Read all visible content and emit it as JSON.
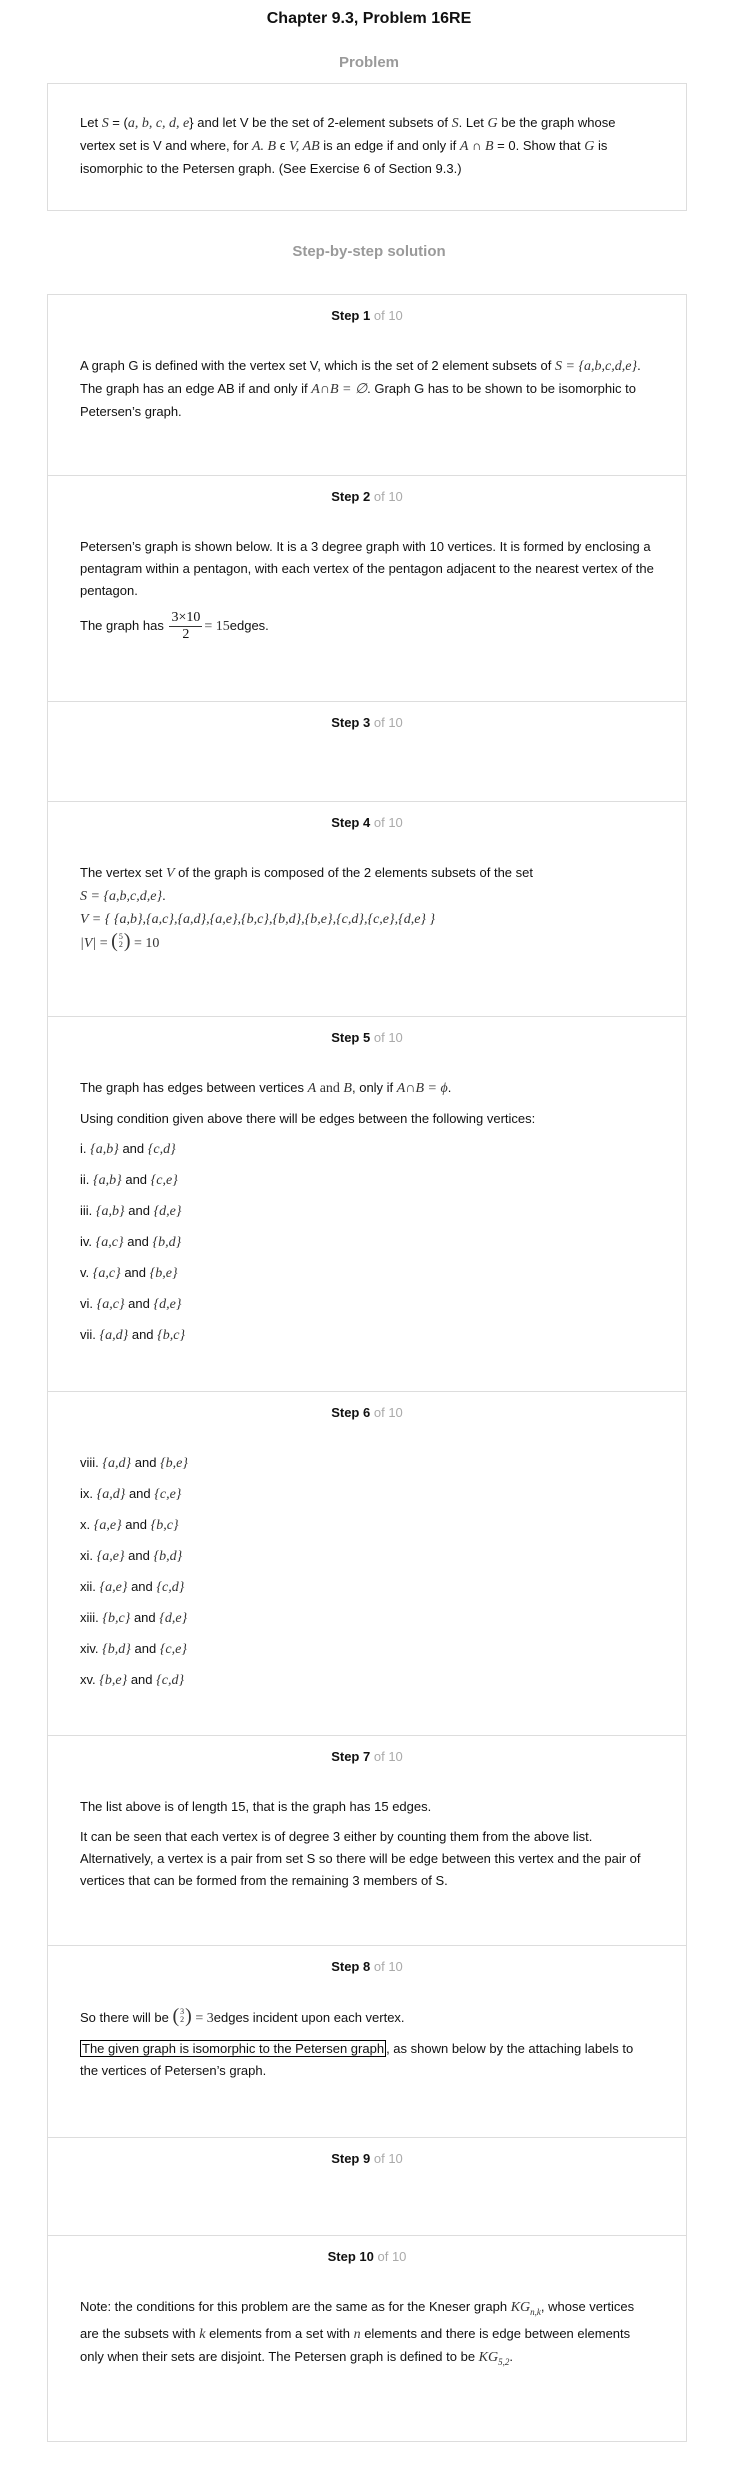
{
  "header": {
    "title": "Chapter 9.3, Problem 16RE",
    "problem_heading": "Problem",
    "solution_heading": "Step-by-step solution"
  },
  "problem": {
    "segments": [
      {
        "text": "Let "
      },
      {
        "math": "S"
      },
      {
        "text": " = ("
      },
      {
        "math": "a, b, c, d, e"
      },
      {
        "text": "} and let V be the set of 2-element subsets of "
      },
      {
        "math": "S"
      },
      {
        "text": ". Let "
      },
      {
        "math": "G"
      },
      {
        "text": " be the graph whose vertex set is V and where, for "
      },
      {
        "math": "A. B"
      },
      {
        "text": " ϵ "
      },
      {
        "math": "V, AB"
      },
      {
        "text": " is an edge if and only if "
      },
      {
        "math": "A"
      },
      {
        "text": " ∩ "
      },
      {
        "math": "B"
      },
      {
        "text": " = 0. Show that "
      },
      {
        "math": "G"
      },
      {
        "text": " is isomorphic to the Petersen graph. (See Exercise 6 of Section 9.3.)"
      }
    ]
  },
  "step_word": "Step",
  "of_total": "of 10",
  "steps": [
    {
      "number": "1",
      "paragraphs": [
        [
          {
            "text": "A graph G is defined with the vertex set V, which is the set of 2 element subsets of "
          },
          {
            "math": "S = {a,b,c,d,e}"
          },
          {
            "text": ". The graph has an edge AB if and only if "
          },
          {
            "math": "A∩B = ∅"
          },
          {
            "text": ". Graph G has to be shown to be isomorphic to Petersen’s graph."
          }
        ]
      ]
    },
    {
      "number": "2",
      "paragraphs": [
        [
          {
            "text": "Petersen’s graph is shown below. It is a 3 degree graph with 10 vertices. It is formed by enclosing a pentagram within a pentagon, with each vertex of the pentagon adjacent to the nearest vertex of the pentagon."
          }
        ],
        [
          {
            "text": "The graph has "
          },
          {
            "frac": [
              "3×10",
              "2"
            ]
          },
          {
            "roman": "= 15"
          },
          {
            "text": "edges."
          }
        ]
      ]
    },
    {
      "number": "3",
      "paragraphs": []
    },
    {
      "number": "4",
      "paragraphs": [
        [
          {
            "text": "The vertex set "
          },
          {
            "math": "V"
          },
          {
            "text": " of the graph is composed of the 2 elements subsets of the set"
          }
        ],
        [
          {
            "math": " S = {a,b,c,d,e}"
          },
          {
            "text": "."
          }
        ],
        [
          {
            "math": " V = { {a,b},{a,c},{a,d},{a,e},{b,c},{b,d},{b,e},{c,d},{c,e},{d,e} }"
          }
        ],
        [
          {
            "math": " |V|"
          },
          {
            "roman": " = "
          },
          {
            "binom": [
              "5",
              "2"
            ]
          },
          {
            "roman": " = 10"
          }
        ]
      ]
    },
    {
      "number": "5",
      "paragraphs": [
        [
          {
            "text": "The graph has edges between vertices "
          },
          {
            "math": "A"
          },
          {
            "roman": " and "
          },
          {
            "math": "B"
          },
          {
            "text": ", only if "
          },
          {
            "math": "A∩B = ϕ"
          },
          {
            "text": "."
          }
        ],
        [
          {
            "text": "Using condition given above there will be edges between the following vertices:"
          }
        ]
      ],
      "items": [
        {
          "num": "i.",
          "a": "{a,b}",
          "and": "and",
          "b": "{c,d}"
        },
        {
          "num": "ii.",
          "a": "{a,b}",
          "and": "and",
          "b": "{c,e}"
        },
        {
          "num": "iii.",
          "a": "{a,b}",
          "and": "and",
          "b": "{d,e}"
        },
        {
          "num": "iv.",
          "a": "{a,c}",
          "and": "and",
          "b": "{b,d}"
        },
        {
          "num": "v.",
          "a": "{a,c}",
          "and": "and",
          "b": "{b,e}"
        },
        {
          "num": "vi.",
          "a": "{a,c}",
          "and": "and",
          "b": "{d,e}"
        },
        {
          "num": "vii.",
          "a": "{a,d}",
          "and": "and",
          "b": "{b,c}"
        }
      ]
    },
    {
      "number": "6",
      "paragraphs": [],
      "items": [
        {
          "num": "viii.",
          "a": "{a,d}",
          "and": "and",
          "b": "{b,e}"
        },
        {
          "num": "ix.",
          "a": "{a,d}",
          "and": "and",
          "b": "{c,e}"
        },
        {
          "num": "x.",
          "a": "{a,e}",
          "and": "and",
          "b": "{b,c}"
        },
        {
          "num": "xi.",
          "a": "{a,e}",
          "and": "and",
          "b": "{b,d}"
        },
        {
          "num": "xii.",
          "a": "{a,e}",
          "and": "and",
          "b": "{c,d}"
        },
        {
          "num": "xiii.",
          "a": "{b,c}",
          "and": "and",
          "b": "{d,e}"
        },
        {
          "num": "xiv.",
          "a": "{b,d}",
          "and": "and",
          "b": "{c,e}"
        },
        {
          "num": "xv.",
          "a": "{b,e}",
          "and": "and",
          "b": "{c,d}"
        }
      ]
    },
    {
      "number": "7",
      "paragraphs": [
        [
          {
            "text": "The list above is of length 15, that is the graph has 15 edges."
          }
        ],
        [
          {
            "text": "It can be seen that each vertex is of degree 3 either by counting them from the above list. Alternatively, a vertex is a pair from set S so there will be edge between this vertex and the pair of vertices that can be formed from the remaining 3 members of S."
          }
        ]
      ]
    },
    {
      "number": "8",
      "paragraphs": [
        [
          {
            "text": "So there will be "
          },
          {
            "binom": [
              "3",
              "2"
            ]
          },
          {
            "roman": " = 3"
          },
          {
            "text": "edges incident upon each vertex."
          }
        ],
        [
          {
            "boxed": "The given graph is isomorphic to the Petersen graph"
          },
          {
            "text": ", as shown below by the attaching labels to the vertices of Petersen’s graph."
          }
        ]
      ]
    },
    {
      "number": "9",
      "paragraphs": []
    },
    {
      "number": "10",
      "paragraphs": [
        [
          {
            "text": "Note: the conditions for this problem are the same as for the Kneser graph "
          },
          {
            "math": "KG",
            "sub": "n,k"
          },
          {
            "text": ", whose vertices are the subsets with "
          },
          {
            "math": "k"
          },
          {
            "text": " elements from a set with "
          },
          {
            "math": "n"
          },
          {
            "text": " elements and there is edge between elements only when their sets are disjoint. The Petersen graph is defined to be "
          },
          {
            "math": " KG",
            "sub": "5,2"
          },
          {
            "text": "."
          }
        ]
      ]
    }
  ]
}
